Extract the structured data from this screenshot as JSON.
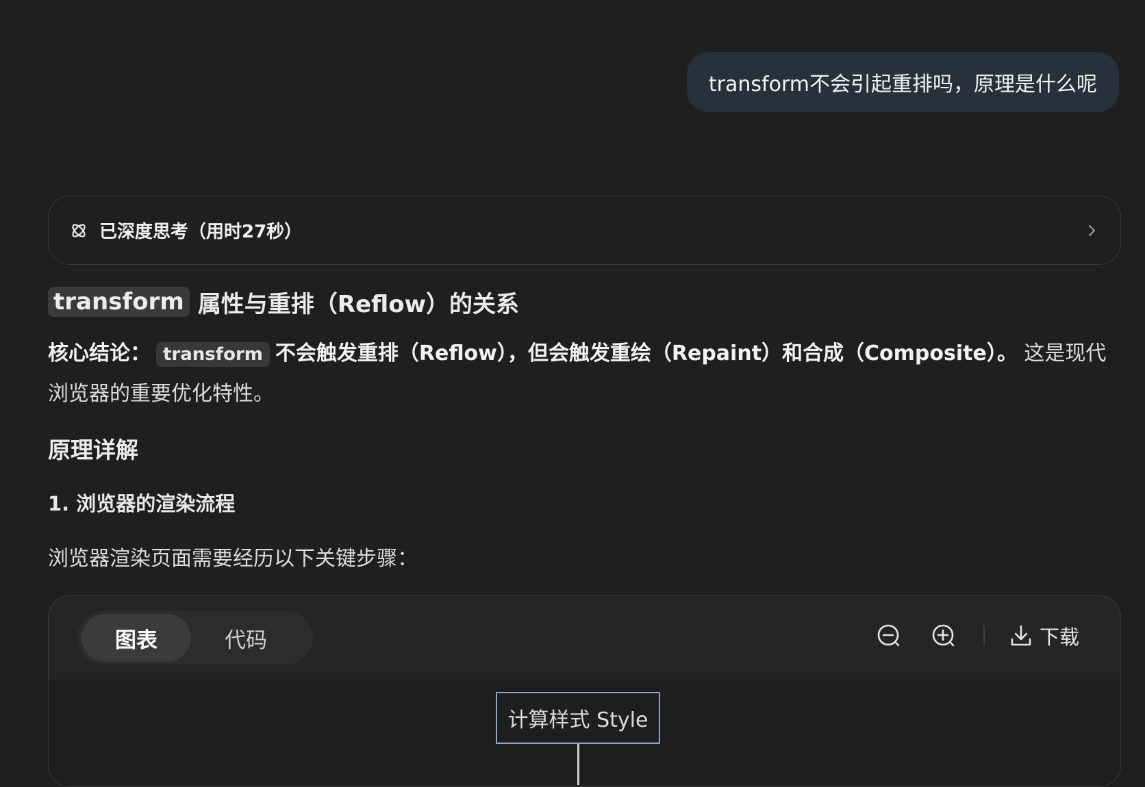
{
  "user_message": "transform不会引起重排吗，原理是什么呢",
  "thinking": {
    "label": "已深度思考（用时27秒）",
    "icon": "deep-think-icon"
  },
  "answer": {
    "title_code": "transform",
    "title_rest": "属性与重排（Reflow）的关系",
    "core_label": "核心结论：",
    "core_code": "transform",
    "core_bold": "不会触发重排（Reflow），但会触发重绘（Repaint）和合成（Composite）。",
    "core_rest": " 这是现代浏览器的重要优化特性。",
    "section_title": "原理详解",
    "sub_title": "1. 浏览器的渲染流程",
    "steps_intro": "浏览器渲染页面需要经历以下关键步骤："
  },
  "diagram_card": {
    "tabs": [
      "图表",
      "代码"
    ],
    "active_tab": "图表",
    "download_label": "下载",
    "node_label": "计算样式 Style"
  },
  "colors": {
    "background": "#1f1f1f",
    "user_bubble": "#27313c",
    "node_border": "#8aa7d6"
  }
}
